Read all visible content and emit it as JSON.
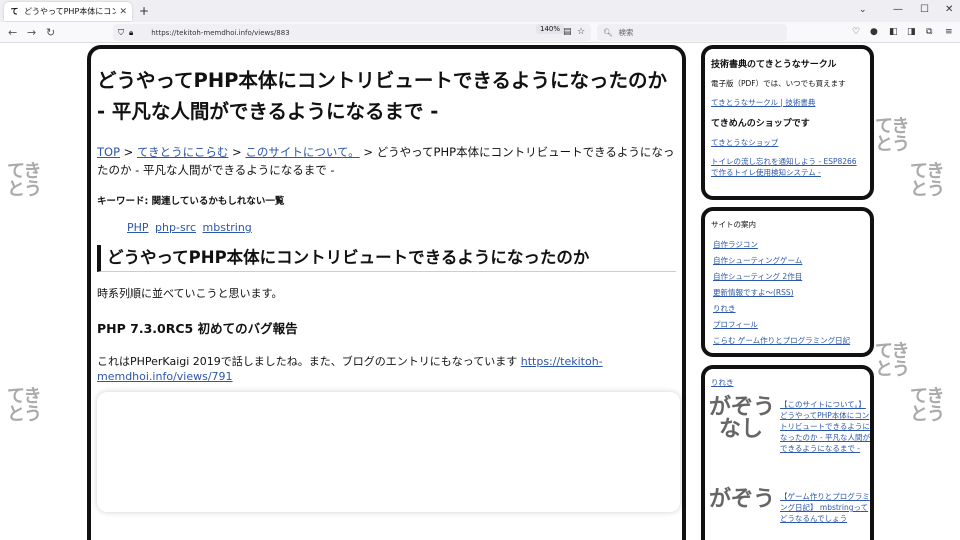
{
  "browser": {
    "tab_title": "どうやってPHP本体にコントリビュートで",
    "tab_favicon": "て",
    "new_tab": "+",
    "url": "https://tekitoh-memdhoi.info/views/883",
    "zoom": "140%",
    "search_placeholder": "検索"
  },
  "article": {
    "title": "どうやってPHP本体にコントリビュートできるようになったのか - 平凡な人間ができるようになるまで -",
    "breadcrumb": {
      "top": "TOP",
      "sep": " > ",
      "cat1": "てきとうにこらむ",
      "cat2": "このサイトについて。",
      "current": "どうやってPHP本体にコントリビュートできるようになったのか - 平凡な人間ができるようになるまで -"
    },
    "keywords_label": "キーワード: 関連しているかもしれない一覧",
    "tags": [
      "PHP",
      "php-src",
      "mbstring"
    ],
    "h2": "どうやってPHP本体にコントリビュートできるようになったのか",
    "intro": "時系列順に並べていこうと思います。",
    "h3": "PHP 7.3.0RC5 初めてのバグ報告",
    "para": "これはPHPerKaigi 2019で話しましたね。また、ブログのエントリにもなっています ",
    "para_link": "https://tekitoh-memdhoi.info/views/791"
  },
  "sidebar": {
    "box1": {
      "heading": "技術書典のてきとうなサークル",
      "text": "電子版（PDF）では、いつでも買えます",
      "link1": "てきとうなサークル | 技術書典",
      "heading2": "てきめんのショップです",
      "link2": "てきとうなショップ",
      "link3": "トイレの流し忘れを通知しよう - ESP8266で作るトイレ使用検知システム -"
    },
    "box2": {
      "label": "サイトの案内",
      "links": [
        "自作ラジコン",
        "自作シューティングゲーム",
        "自作シューティング 2作目",
        "更新情報ですよ〜(RSS)",
        "りれき",
        "プロフィール",
        "こらむ ゲーム作りとプログラミング日記"
      ]
    },
    "box3": {
      "label": "りれき",
      "item1": "【このサイトについて。】 どうやってPHP本体にコントリビュートできるようになったのか - 平凡な人間ができるようになるまで -",
      "item2": "【ゲーム作りとプログラミング日記】 mbstringってどうなるんでしょう"
    }
  },
  "deco": {
    "text": "てきとう",
    "pix1": "がぞう",
    "pix2": "なし"
  }
}
